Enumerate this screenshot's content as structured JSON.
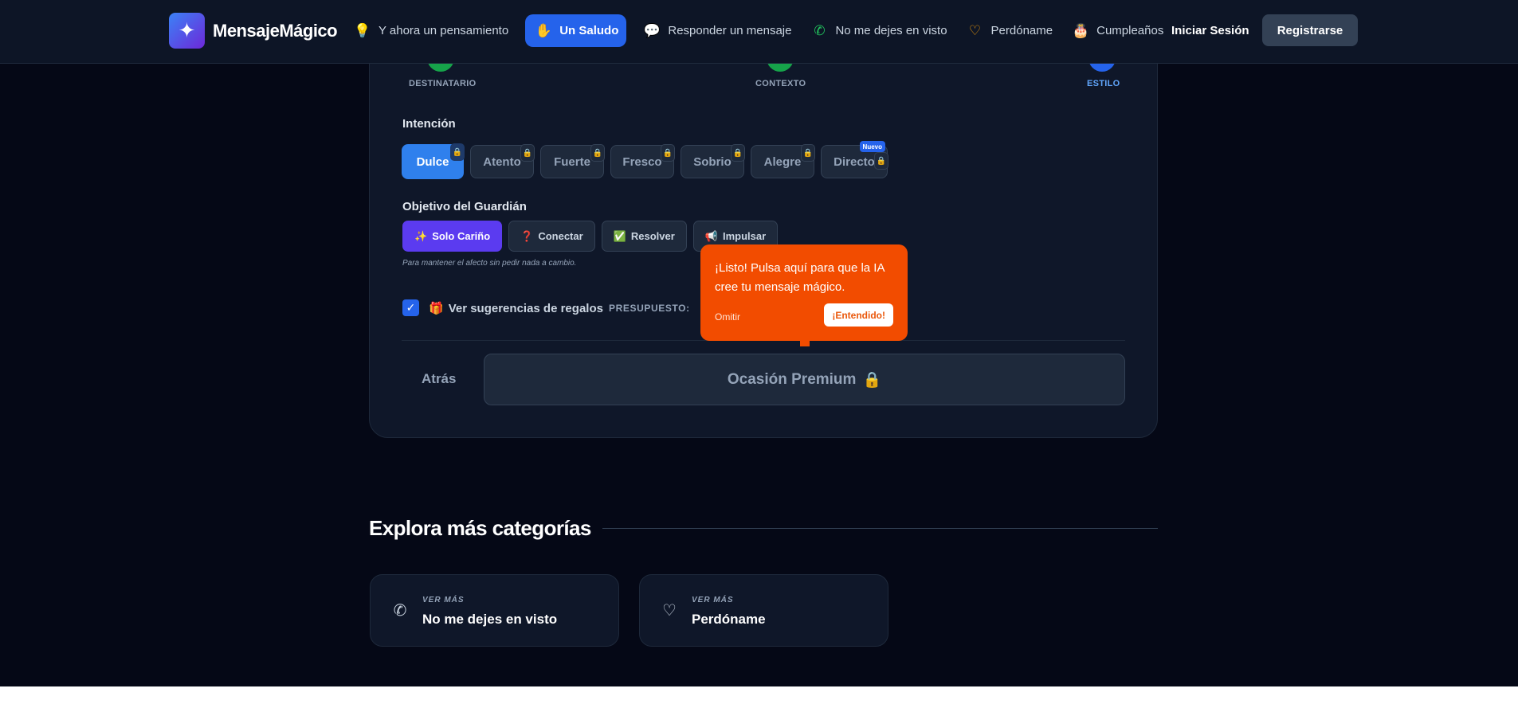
{
  "brand": {
    "name": "MensajeMágico"
  },
  "nav": {
    "items": [
      {
        "label": "Y ahora un pensamiento",
        "icon": "lightbulb-icon"
      },
      {
        "label": "Un Saludo",
        "icon": "waving-hand-icon"
      },
      {
        "label": "Responder un mensaje",
        "icon": "chat-bubble-icon"
      },
      {
        "label": "No me dejes en visto",
        "icon": "whatsapp-icon"
      },
      {
        "label": "Perdóname",
        "icon": "heart-icon"
      },
      {
        "label": "Cumpleaños",
        "icon": "cake-icon"
      }
    ],
    "login": "Iniciar Sesión",
    "register": "Registrarse"
  },
  "stepper": {
    "steps": [
      "DESTINATARIO",
      "CONTEXTO",
      "ESTILO"
    ]
  },
  "intention": {
    "title": "Intención",
    "options": [
      "Dulce",
      "Atento",
      "Fuerte",
      "Fresco",
      "Sobrio",
      "Alegre",
      "Directo"
    ],
    "badge_new": "Nuevo"
  },
  "goal": {
    "title": "Objetivo del Guardián",
    "options": [
      {
        "label": "Solo Cariño",
        "icon": "✨"
      },
      {
        "label": "Conectar",
        "icon": "❓"
      },
      {
        "label": "Resolver",
        "icon": "✅"
      },
      {
        "label": "Impulsar",
        "icon": "📢"
      }
    ],
    "note": "Para mantener el afecto sin pedir nada a cambio."
  },
  "gifts": {
    "label": "Ver sugerencias de regalos",
    "budget_label": "PRESUPUESTO:"
  },
  "actions": {
    "back": "Atrás",
    "premium": "Ocasión Premium"
  },
  "tooltip": {
    "text": "¡Listo! Pulsa aquí para que la IA cree tu mensaje mágico.",
    "skip": "Omitir",
    "ok": "¡Entendido!"
  },
  "explore": {
    "title": "Explora más categorías",
    "cards": [
      {
        "kicker": "VER MÁS",
        "title": "No me dejes en visto",
        "icon": "whatsapp-icon"
      },
      {
        "kicker": "VER MÁS",
        "title": "Perdóname",
        "icon": "heart-icon"
      }
    ]
  },
  "colors": {
    "accent": "#2563eb",
    "goal_active": "#5b3bf0",
    "tooltip": "#f24c00",
    "background": "#050816"
  }
}
